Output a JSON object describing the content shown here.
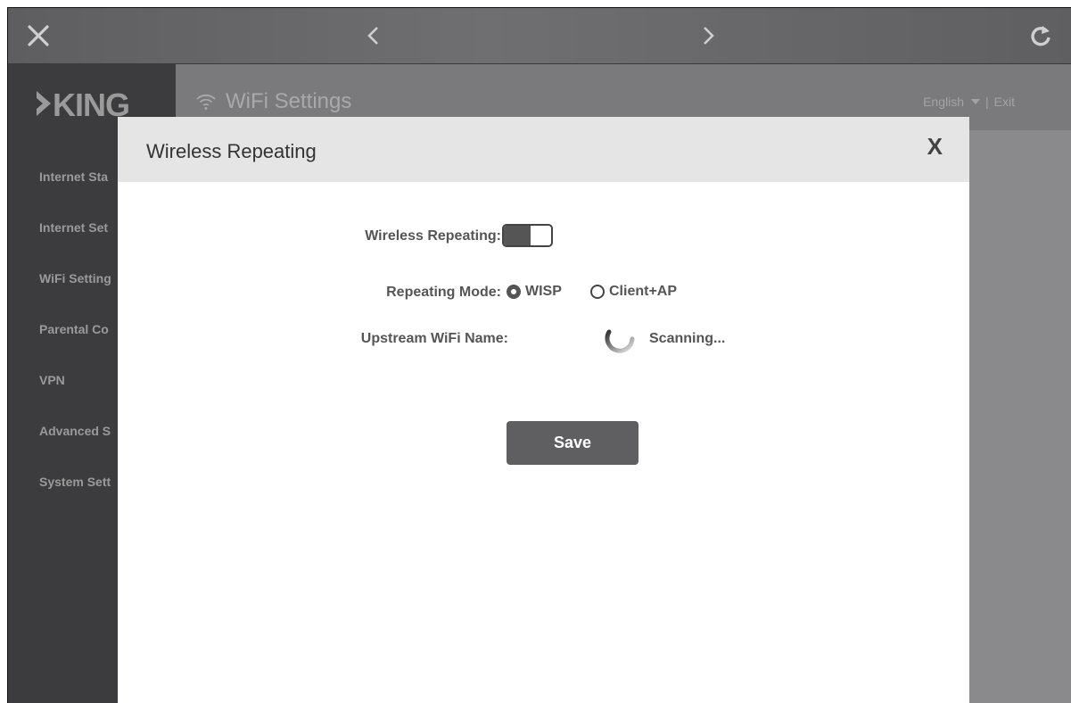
{
  "topbar": {
    "close_icon": "close-x-icon",
    "back_icon": "chevron-left-icon",
    "forward_icon": "chevron-right-icon",
    "refresh_icon": "refresh-icon"
  },
  "brand": {
    "logo_text": "KING"
  },
  "sidebar": {
    "items": [
      {
        "label": "Internet Sta"
      },
      {
        "label": "Internet Set"
      },
      {
        "label": "WiFi Setting"
      },
      {
        "label": "Parental Co"
      },
      {
        "label": "VPN"
      },
      {
        "label": "Advanced S"
      },
      {
        "label": "System Sett"
      }
    ]
  },
  "header": {
    "title": "WiFi Settings",
    "language": "English",
    "separator": "|",
    "exit_label": "Exit"
  },
  "modal": {
    "title": "Wireless Repeating",
    "close_label": "X",
    "wireless_repeating_label": "Wireless Repeating:",
    "wireless_repeating_enabled": false,
    "repeating_mode_label": "Repeating Mode:",
    "modes": [
      {
        "label": "WISP",
        "selected": true
      },
      {
        "label": "Client+AP",
        "selected": false
      }
    ],
    "upstream_label": "Upstream WiFi Name:",
    "scanning_text": "Scanning...",
    "save_label": "Save"
  },
  "colors": {
    "topbar": "#6a6a6c",
    "sidebar": "#3c3c3e",
    "modal_header": "#e5e5e6",
    "button": "#5f5f61"
  }
}
